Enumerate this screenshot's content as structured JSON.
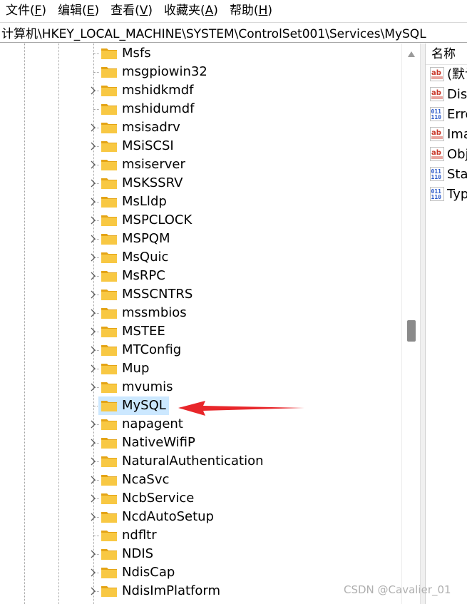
{
  "menubar": {
    "items": [
      {
        "label": "文件(",
        "acc": "F",
        "end": ")"
      },
      {
        "label": "编辑(",
        "acc": "E",
        "end": ")"
      },
      {
        "label": "查看(",
        "acc": "V",
        "end": ")"
      },
      {
        "label": "收藏夹(",
        "acc": "A",
        "end": ")"
      },
      {
        "label": "帮助(",
        "acc": "H",
        "end": ")"
      }
    ]
  },
  "address": {
    "path": "计算机\\HKEY_LOCAL_MACHINE\\SYSTEM\\ControlSet001\\Services\\MySQL"
  },
  "tree": {
    "items": [
      {
        "label": "Msfs",
        "expandable": false
      },
      {
        "label": "msgpiowin32",
        "expandable": false
      },
      {
        "label": "mshidkmdf",
        "expandable": true
      },
      {
        "label": "mshidumdf",
        "expandable": false
      },
      {
        "label": "msisadrv",
        "expandable": true
      },
      {
        "label": "MSiSCSI",
        "expandable": true
      },
      {
        "label": "msiserver",
        "expandable": true
      },
      {
        "label": "MSKSSRV",
        "expandable": true
      },
      {
        "label": "MsLldp",
        "expandable": true
      },
      {
        "label": "MSPCLOCK",
        "expandable": true
      },
      {
        "label": "MSPQM",
        "expandable": true
      },
      {
        "label": "MsQuic",
        "expandable": true
      },
      {
        "label": "MsRPC",
        "expandable": true
      },
      {
        "label": "MSSCNTRS",
        "expandable": true
      },
      {
        "label": "mssmbios",
        "expandable": true
      },
      {
        "label": "MSTEE",
        "expandable": true
      },
      {
        "label": "MTConfig",
        "expandable": true
      },
      {
        "label": "Mup",
        "expandable": true
      },
      {
        "label": "mvumis",
        "expandable": true
      },
      {
        "label": "MySQL",
        "expandable": false,
        "selected": true
      },
      {
        "label": "napagent",
        "expandable": true
      },
      {
        "label": "NativeWifiP",
        "expandable": true
      },
      {
        "label": "NaturalAuthentication",
        "expandable": true
      },
      {
        "label": "NcaSvc",
        "expandable": true
      },
      {
        "label": "NcbService",
        "expandable": true
      },
      {
        "label": "NcdAutoSetup",
        "expandable": true
      },
      {
        "label": "ndfltr",
        "expandable": false
      },
      {
        "label": "NDIS",
        "expandable": true
      },
      {
        "label": "NdisCap",
        "expandable": true
      },
      {
        "label": "NdisImPlatform",
        "expandable": true
      }
    ]
  },
  "values": {
    "column_name": "名称",
    "items": [
      {
        "name": "(默认)",
        "type": "string"
      },
      {
        "name": "DisplayName",
        "type": "string"
      },
      {
        "name": "ErrorControl",
        "type": "dword"
      },
      {
        "name": "ImagePath",
        "type": "string"
      },
      {
        "name": "ObjectName",
        "type": "string"
      },
      {
        "name": "Start",
        "type": "dword"
      },
      {
        "name": "Type",
        "type": "dword"
      }
    ]
  },
  "watermark": "CSDN @Cavalier_01",
  "colors": {
    "selection": "#cce8ff",
    "folder": "#f8c843",
    "folder_dark": "#e4a416",
    "arrow": "#e8262a",
    "string_icon": "#c8382a",
    "dword_icon": "#2a59c8"
  }
}
